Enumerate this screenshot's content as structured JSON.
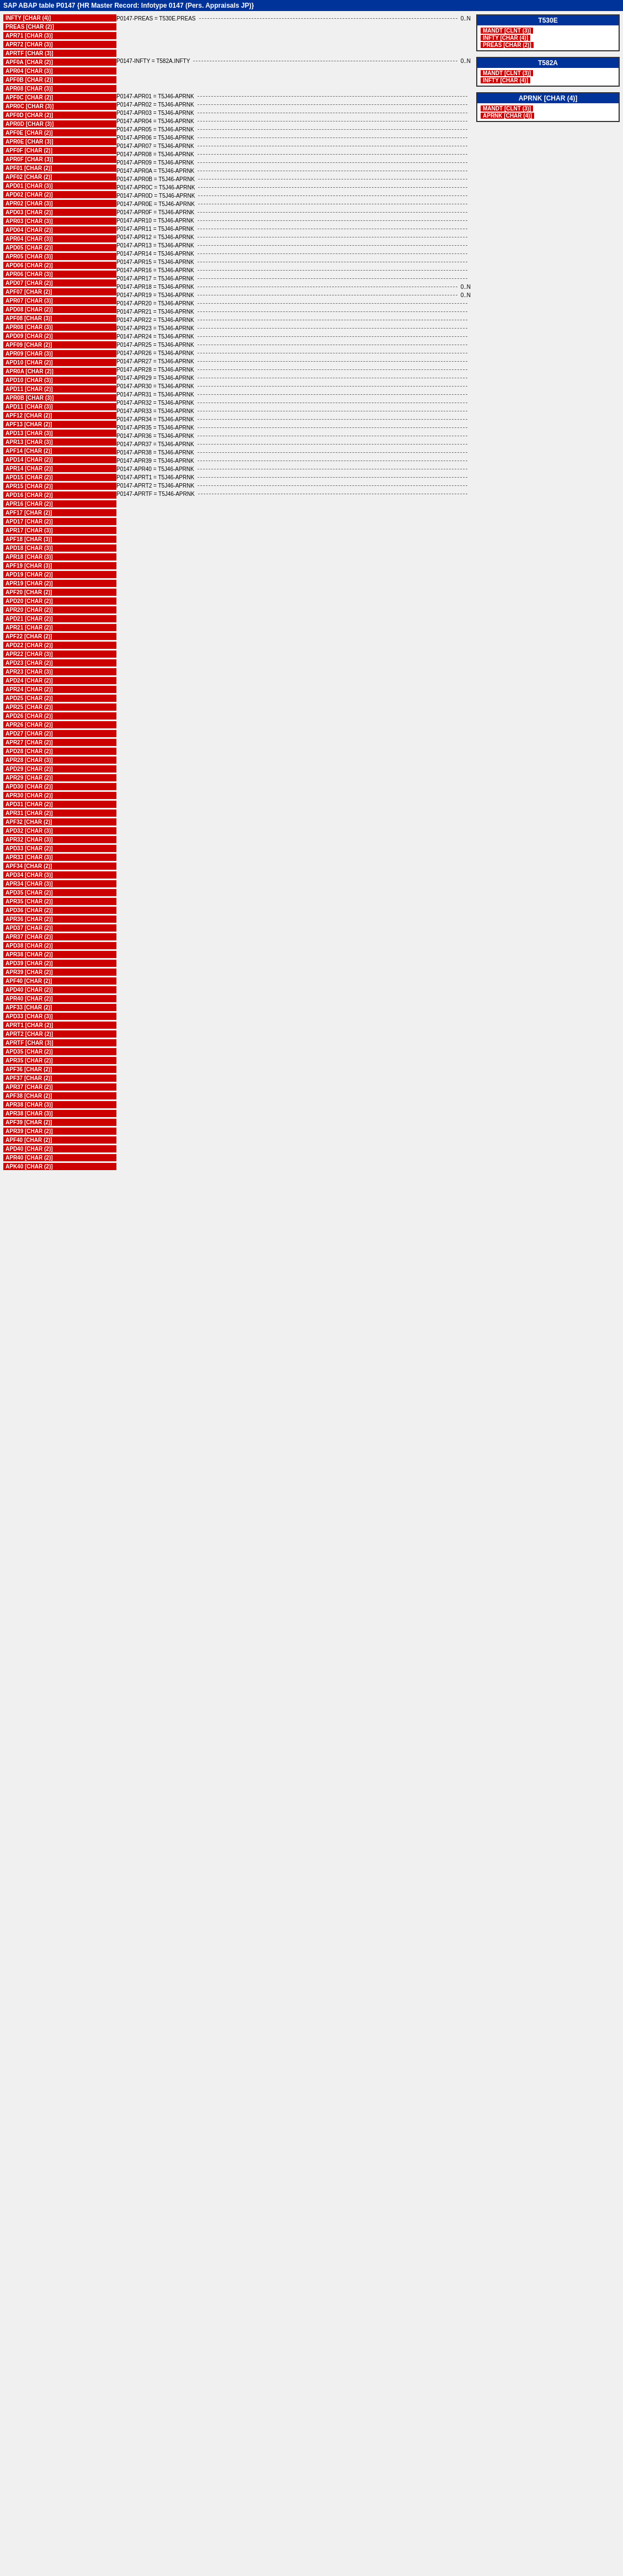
{
  "title": "SAP ABAP table P0147 {HR Master Record: Infotype 0147 (Pers. Appraisals JP)}",
  "left_items": [
    {
      "red": "INFTY [CHAR (4)]",
      "gray": null
    },
    {
      "red": "PREAS [CHAR (2)]",
      "gray": null
    },
    {
      "red": "APR71 [CHAR (3)]",
      "gray": null
    },
    {
      "red": "APR72 [CHAR (3)]",
      "gray": null
    },
    {
      "red": "APRTF [CHAR (3)]",
      "gray": null
    },
    {
      "red": "APF0A [CHAR (2)]",
      "gray": null
    },
    {
      "red": "APR04 [CHAR (3)]",
      "gray": null
    },
    {
      "red": "APF0B [CHAR (2)]",
      "gray": null
    },
    {
      "red": "APR08 [CHAR (3)]",
      "gray": null
    },
    {
      "red": "APF0C [CHAR (2)]",
      "gray": null
    },
    {
      "red": "APR0C [CHAR (3)]",
      "gray": null
    },
    {
      "red": "APF0D [CHAR (2)]",
      "gray": null
    },
    {
      "red": "APR0D [CHAR (3)]",
      "gray": null
    },
    {
      "red": "APF0E [CHAR (2)]",
      "gray": null
    },
    {
      "red": "APR0E [CHAR (3)]",
      "gray": null
    },
    {
      "red": "APF0F [CHAR (2)]",
      "gray": null
    },
    {
      "red": "APR0F [CHAR (3)]",
      "gray": null
    },
    {
      "red": "APF01 [CHAR (2)]",
      "gray": null
    },
    {
      "red": "APF02 [CHAR (2)]",
      "gray": null
    },
    {
      "red": "APD01 [CHAR (3)]",
      "gray": null
    },
    {
      "red": "APD02 [CHAR (2)]",
      "gray": null
    },
    {
      "red": "APR02 [CHAR (3)]",
      "gray": null
    },
    {
      "red": "APD03 [CHAR (2)]",
      "gray": null
    },
    {
      "red": "APR03 [CHAR (3)]",
      "gray": null
    },
    {
      "red": "APD04 [CHAR (2)]",
      "gray": null
    },
    {
      "red": "APR04 [CHAR (3)]",
      "gray": null
    },
    {
      "red": "APD05 [CHAR (2)]",
      "gray": null
    },
    {
      "red": "APR05 [CHAR (3)]",
      "gray": null
    },
    {
      "red": "APD06 [CHAR (2)]",
      "gray": null
    },
    {
      "red": "APR06 [CHAR (3)]",
      "gray": null
    },
    {
      "red": "APD07 [CHAR (2)]",
      "gray": null
    },
    {
      "red": "APF07 [CHAR (2)]",
      "gray": null
    },
    {
      "red": "APR07 [CHAR (3)]",
      "gray": null
    },
    {
      "red": "APD08 [CHAR (2)]",
      "gray": null
    },
    {
      "red": "APF08 [CHAR (3)]",
      "gray": null
    },
    {
      "red": "APR08 [CHAR (3)]",
      "gray": null
    },
    {
      "red": "APD09 [CHAR (2)]",
      "gray": null
    },
    {
      "red": "APF09 [CHAR (2)]",
      "gray": null
    },
    {
      "red": "APR09 [CHAR (3)]",
      "gray": null
    },
    {
      "red": "APD10 [CHAR (2)]",
      "gray": null
    },
    {
      "red": "APR0A [CHAR (2)]",
      "gray": null
    },
    {
      "red": "APD10 [CHAR (3)]",
      "gray": null
    },
    {
      "red": "APD11 [CHAR (2)]",
      "gray": null
    },
    {
      "red": "APR0B [CHAR (3)]",
      "gray": null
    },
    {
      "red": "APD11 [CHAR (3)]",
      "gray": null
    },
    {
      "red": "APF12 [CHAR (2)]",
      "gray": null
    },
    {
      "red": "APF13 [CHAR (2)]",
      "gray": null
    },
    {
      "red": "APD13 [CHAR (3)]",
      "gray": null
    },
    {
      "red": "APR13 [CHAR (3)]",
      "gray": null
    },
    {
      "red": "APF14 [CHAR (2)]",
      "gray": null
    },
    {
      "red": "APD14 [CHAR (2)]",
      "gray": null
    },
    {
      "red": "APR14 [CHAR (2)]",
      "gray": null
    },
    {
      "red": "APD15 [CHAR (2)]",
      "gray": null
    },
    {
      "red": "APR15 [CHAR (2)]",
      "gray": null
    },
    {
      "red": "APD16 [CHAR (2)]",
      "gray": null
    },
    {
      "red": "APR16 [CHAR (2)]",
      "gray": null
    },
    {
      "red": "APF17 [CHAR (2)]",
      "gray": null
    },
    {
      "red": "APD17 [CHAR (2)]",
      "gray": null
    },
    {
      "red": "APR17 [CHAR (3)]",
      "gray": null
    },
    {
      "red": "APF18 [CHAR (3)]",
      "gray": null
    },
    {
      "red": "APD18 [CHAR (3)]",
      "gray": null
    },
    {
      "red": "APR18 [CHAR (3)]",
      "gray": null
    },
    {
      "red": "APF19 [CHAR (3)]",
      "gray": null
    },
    {
      "red": "APD19 [CHAR (2)]",
      "gray": null
    },
    {
      "red": "APR19 [CHAR (2)]",
      "gray": null
    },
    {
      "red": "APF20 [CHAR (2)]",
      "gray": null
    },
    {
      "red": "APD20 [CHAR (2)]",
      "gray": null
    },
    {
      "red": "APR20 [CHAR (2)]",
      "gray": null
    },
    {
      "red": "APD21 [CHAR (2)]",
      "gray": null
    },
    {
      "red": "APR21 [CHAR (2)]",
      "gray": null
    },
    {
      "red": "APF22 [CHAR (2)]",
      "gray": null
    },
    {
      "red": "APD22 [CHAR (2)]",
      "gray": null
    },
    {
      "red": "APR22 [CHAR (3)]",
      "gray": null
    },
    {
      "red": "APD23 [CHAR (2)]",
      "gray": null
    },
    {
      "red": "APR23 [CHAR (3)]",
      "gray": null
    },
    {
      "red": "APD24 [CHAR (2)]",
      "gray": null
    },
    {
      "red": "APR24 [CHAR (2)]",
      "gray": null
    },
    {
      "red": "APD25 [CHAR (2)]",
      "gray": null
    },
    {
      "red": "APR25 [CHAR (2)]",
      "gray": null
    },
    {
      "red": "APD26 [CHAR (2)]",
      "gray": null
    },
    {
      "red": "APR26 [CHAR (2)]",
      "gray": null
    },
    {
      "red": "APD27 [CHAR (2)]",
      "gray": null
    },
    {
      "red": "APR27 [CHAR (2)]",
      "gray": null
    },
    {
      "red": "APD28 [CHAR (2)]",
      "gray": null
    },
    {
      "red": "APR28 [CHAR (3)]",
      "gray": null
    },
    {
      "red": "APD29 [CHAR (2)]",
      "gray": null
    },
    {
      "red": "APR29 [CHAR (2)]",
      "gray": null
    },
    {
      "red": "APD30 [CHAR (2)]",
      "gray": null
    },
    {
      "red": "APR30 [CHAR (2)]",
      "gray": null
    },
    {
      "red": "APD31 [CHAR (2)]",
      "gray": null
    },
    {
      "red": "APR31 [CHAR (2)]",
      "gray": null
    },
    {
      "red": "APF32 [CHAR (2)]",
      "gray": null
    },
    {
      "red": "APD32 [CHAR (3)]",
      "gray": null
    },
    {
      "red": "APR32 [CHAR (3)]",
      "gray": null
    },
    {
      "red": "APD33 [CHAR (2)]",
      "gray": null
    },
    {
      "red": "APR33 [CHAR (3)]",
      "gray": null
    },
    {
      "red": "APF34 [CHAR (2)]",
      "gray": null
    },
    {
      "red": "APD34 [CHAR (3)]",
      "gray": null
    },
    {
      "red": "APR34 [CHAR (3)]",
      "gray": null
    },
    {
      "red": "APD35 [CHAR (2)]",
      "gray": null
    },
    {
      "red": "APR35 [CHAR (2)]",
      "gray": null
    },
    {
      "red": "APD36 [CHAR (2)]",
      "gray": null
    },
    {
      "red": "APR36 [CHAR (2)]",
      "gray": null
    },
    {
      "red": "APD37 [CHAR (2)]",
      "gray": null
    },
    {
      "red": "APR37 [CHAR (2)]",
      "gray": null
    },
    {
      "red": "APD38 [CHAR (2)]",
      "gray": null
    },
    {
      "red": "APR38 [CHAR (2)]",
      "gray": null
    },
    {
      "red": "APD39 [CHAR (2)]",
      "gray": null
    },
    {
      "red": "APR39 [CHAR (2)]",
      "gray": null
    },
    {
      "red": "APF40 [CHAR (2)]",
      "gray": null
    },
    {
      "red": "APD40 [CHAR (2)]",
      "gray": null
    },
    {
      "red": "APR40 [CHAR (2)]",
      "gray": null
    },
    {
      "red": "APF33 [CHAR (2)]",
      "gray": null
    },
    {
      "red": "APD33 [CHAR (3)]",
      "gray": null
    },
    {
      "red": "APRT1 [CHAR (2)]",
      "gray": null
    },
    {
      "red": "APRT2 [CHAR (2)]",
      "gray": null
    },
    {
      "red": "APRTF [CHAR (3)]",
      "gray": null
    },
    {
      "red": "APD35 [CHAR (2)]",
      "gray": null
    },
    {
      "red": "APR35 [CHAR (2)]",
      "gray": null
    },
    {
      "red": "APF36 [CHAR (2)]",
      "gray": null
    },
    {
      "red": "APF37 [CHAR (2)]",
      "gray": null
    },
    {
      "red": "APR37 [CHAR (2)]",
      "gray": null
    },
    {
      "red": "APF38 [CHAR (2)]",
      "gray": null
    },
    {
      "red": "APR38 [CHAR (3)]",
      "gray": null
    },
    {
      "red": "APR38 [CHAR (3)]",
      "gray": null
    },
    {
      "red": "APF39 [CHAR (2)]",
      "gray": null
    },
    {
      "red": "APR39 [CHAR (2)]",
      "gray": null
    },
    {
      "red": "APF40 [CHAR (2)]",
      "gray": null
    },
    {
      "red": "APD40 [CHAR (2)]",
      "gray": null
    },
    {
      "red": "APR40 [CHAR (2)]",
      "gray": null
    },
    {
      "red": "APK40 [CHAR (2)]",
      "gray": null
    }
  ],
  "middle_entries": [
    {
      "label": "P0147-PREAS = T530E.PREAS",
      "end": "0..N"
    },
    {
      "label": "P0147-INFTY = T582A.INFTY",
      "end": "0..N"
    },
    {
      "label": "P0147-APR01 = T5J46-APRNK",
      "end": ""
    },
    {
      "label": "P0147-APR02 = T5J46-APRNK",
      "end": ""
    },
    {
      "label": "P0147-APR03 = T5J46-APRNK",
      "end": ""
    },
    {
      "label": "P0147-APR04 = T5J46-APRNK",
      "end": ""
    },
    {
      "label": "P0147-APR05 = T5J46-APRNK",
      "end": ""
    },
    {
      "label": "P0147-APR06 = T5J46-APRNK",
      "end": ""
    },
    {
      "label": "P0147-APR07 = T5J46-APRNK",
      "end": ""
    },
    {
      "label": "P0147-APR08 = T5J46-APRNK",
      "end": ""
    },
    {
      "label": "P0147-APR09 = T5J46-APRNK",
      "end": ""
    },
    {
      "label": "P0147-APR0A = T5J46-APRNK",
      "end": ""
    },
    {
      "label": "P0147-APR0B = T5J46-APRNK",
      "end": ""
    },
    {
      "label": "P0147-APR0C = T5J46-APRNK",
      "end": ""
    },
    {
      "label": "P0147-APR0D = T5J46-APRNK",
      "end": ""
    },
    {
      "label": "P0147-APR0E = T5J46-APRNK",
      "end": ""
    },
    {
      "label": "P0147-APR0F = T5J46-APRNK",
      "end": ""
    },
    {
      "label": "P0147-APR10 = T5J46-APRNK",
      "end": ""
    },
    {
      "label": "P0147-APR11 = T5J46-APRNK",
      "end": ""
    },
    {
      "label": "P0147-APR12 = T5J46-APRNK",
      "end": ""
    },
    {
      "label": "P0147-APR13 = T5J46-APRNK",
      "end": ""
    },
    {
      "label": "P0147-APR14 = T5J46-APRNK",
      "end": ""
    },
    {
      "label": "P0147-APR15 = T5J46-APRNK",
      "end": ""
    },
    {
      "label": "P0147-APR16 = T5J46-APRNK",
      "end": ""
    },
    {
      "label": "P0147-APR17 = T5J46-APRNK",
      "end": ""
    },
    {
      "label": "P0147-APR18 = T5J46-APRNK",
      "end": "0..N"
    },
    {
      "label": "P0147-APR19 = T5J46-APRNK",
      "end": "0..N"
    },
    {
      "label": "P0147-APR20 = T5J46-APRNK",
      "end": ""
    },
    {
      "label": "P0147-APR21 = T5J46-APRNK",
      "end": ""
    },
    {
      "label": "P0147-APR22 = T5J46-APRNK",
      "end": ""
    },
    {
      "label": "P0147-APR23 = T5J46-APRNK",
      "end": ""
    },
    {
      "label": "P0147-APR24 = T5J46-APRNK",
      "end": ""
    },
    {
      "label": "P0147-APR25 = T5J46-APRNK",
      "end": ""
    },
    {
      "label": "P0147-APR26 = T5J46-APRNK",
      "end": ""
    },
    {
      "label": "P0147-APR27 = T5J46-APRNK",
      "end": ""
    },
    {
      "label": "P0147-APR28 = T5J46-APRNK",
      "end": ""
    },
    {
      "label": "P0147-APR29 = T5J46-APRNK",
      "end": ""
    },
    {
      "label": "P0147-APR30 = T5J46-APRNK",
      "end": ""
    },
    {
      "label": "P0147-APR31 = T5J46-APRNK",
      "end": ""
    },
    {
      "label": "P0147-APR32 = T5J46-APRNK",
      "end": ""
    },
    {
      "label": "P0147-APR33 = T5J46-APRNK",
      "end": ""
    },
    {
      "label": "P0147-APR34 = T5J46-APRNK",
      "end": ""
    },
    {
      "label": "P0147-APR35 = T5J46-APRNK",
      "end": ""
    },
    {
      "label": "P0147-APR36 = T5J46-APRNK",
      "end": ""
    },
    {
      "label": "P0147-APR37 = T5J46-APRNK",
      "end": ""
    },
    {
      "label": "P0147-APR38 = T5J46-APRNK",
      "end": ""
    },
    {
      "label": "P0147-APR39 = T5J46-APRNK",
      "end": ""
    },
    {
      "label": "P0147-APR40 = T5J46-APRNK",
      "end": ""
    },
    {
      "label": "P0147-APRT1 = T5J46-APRNK",
      "end": ""
    },
    {
      "label": "P0147-APRT2 = T5J46-APRNK",
      "end": ""
    },
    {
      "label": "P0147-APRTF = T5J46-APRNK",
      "end": ""
    }
  ],
  "box_t530e": {
    "title": "T530E",
    "rows": [
      {
        "red": "MANDT [CLNT (3)]"
      },
      {
        "red": "INFTY [CHAR (4)]"
      },
      {
        "red": "PREAS [CHAR (2)]"
      }
    ]
  },
  "box_t582a": {
    "title": "T582A",
    "rows": [
      {
        "red": "MANDT [CLNT (3)]"
      },
      {
        "red": "INFTY [CHAR (4)]"
      }
    ]
  },
  "box_t5j46": {
    "title": "APRNK [CHAR (4)]",
    "rows": [
      {
        "red": "MANDT [CLNT (3)]"
      },
      {
        "red": "APRNK [CHAR (4)]"
      }
    ]
  }
}
